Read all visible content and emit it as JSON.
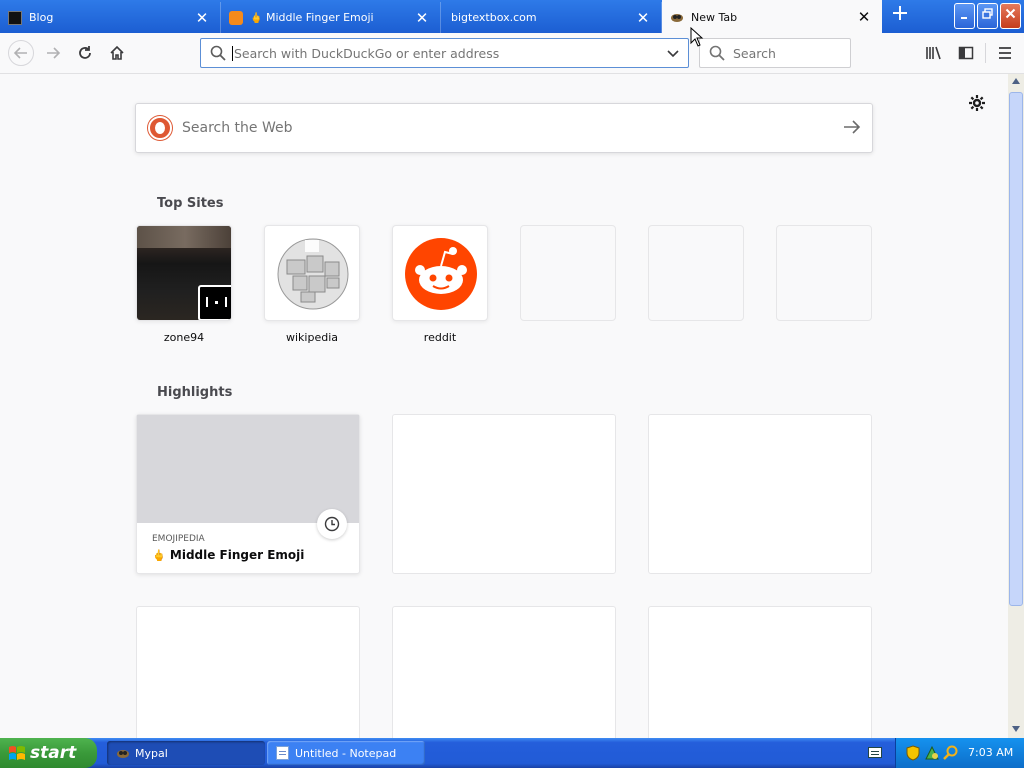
{
  "tabs": [
    {
      "title": "Blog",
      "close": "✕"
    },
    {
      "title": "Middle Finger Emoji",
      "emoji": "🖕",
      "close": "✕"
    },
    {
      "title": "bigtextbox.com",
      "close": "✕"
    },
    {
      "title": "New Tab",
      "close": "✕",
      "active": true
    }
  ],
  "toolbar": {
    "url_placeholder": "Search with DuckDuckGo or enter address",
    "search_placeholder": "Search"
  },
  "content": {
    "websearch_placeholder": "Search the Web",
    "top_sites_title": "Top Sites",
    "highlights_title": "Highlights",
    "top_sites": [
      {
        "label": "zone94"
      },
      {
        "label": "wikipedia"
      },
      {
        "label": "reddit"
      }
    ],
    "highlight": {
      "source": "EMOJIPEDIA",
      "title": "Middle Finger Emoji",
      "emoji": "🖕"
    }
  },
  "taskbar": {
    "start_label": "start",
    "items": [
      {
        "label": "Mypal"
      },
      {
        "label": "Untitled - Notepad"
      }
    ],
    "clock": "7:03 AM"
  },
  "colors": {
    "reddit": "#ff4500",
    "tabbar": "#1c5ed2",
    "accent": "#0060df"
  }
}
